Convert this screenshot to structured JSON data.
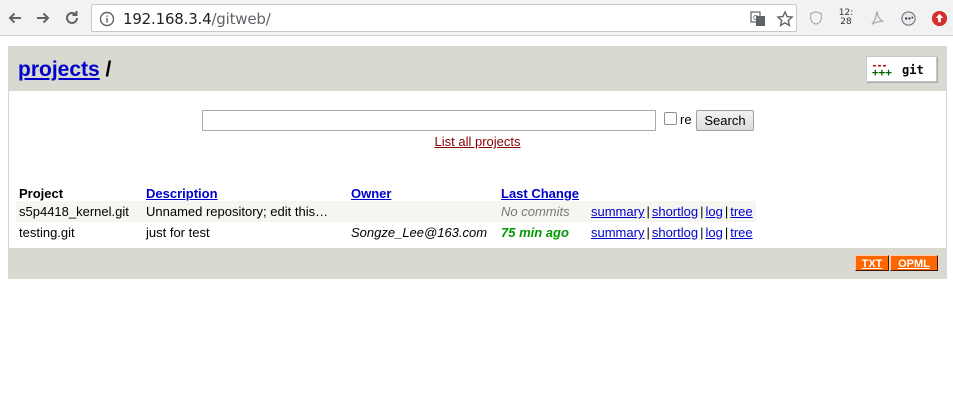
{
  "browser": {
    "url_host": "192.168.3.4",
    "url_path": "/gitweb/",
    "clock_hour": "12:",
    "clock_min": "28"
  },
  "header": {
    "projects_link": "projects",
    "separator": " /",
    "logo_marks": "+++",
    "logo_text": "git"
  },
  "search": {
    "value": "",
    "re_label": "re",
    "button_label": "Search",
    "list_all_label": "List all projects"
  },
  "table": {
    "headers": {
      "project": "Project",
      "description": "Description",
      "owner": "Owner",
      "last_change": "Last Change"
    },
    "rows": [
      {
        "project": "s5p4418_kernel.git",
        "description": "Unnamed repository; edit this…",
        "owner": "",
        "last_change": "No commits",
        "links": [
          "summary",
          "shortlog",
          "log",
          "tree"
        ]
      },
      {
        "project": "testing.git",
        "description": "just for test",
        "owner": "Songze_Lee@163.com",
        "last_change": "75 min ago",
        "links": [
          "summary",
          "shortlog",
          "log",
          "tree"
        ]
      }
    ]
  },
  "footer": {
    "txt_label": "TXT",
    "opml_label": "OPML"
  },
  "colors": {
    "header_bg": "#d9d8d1",
    "link": "#0000cc",
    "feed": "#ff6600",
    "age_recent": "#009900"
  }
}
